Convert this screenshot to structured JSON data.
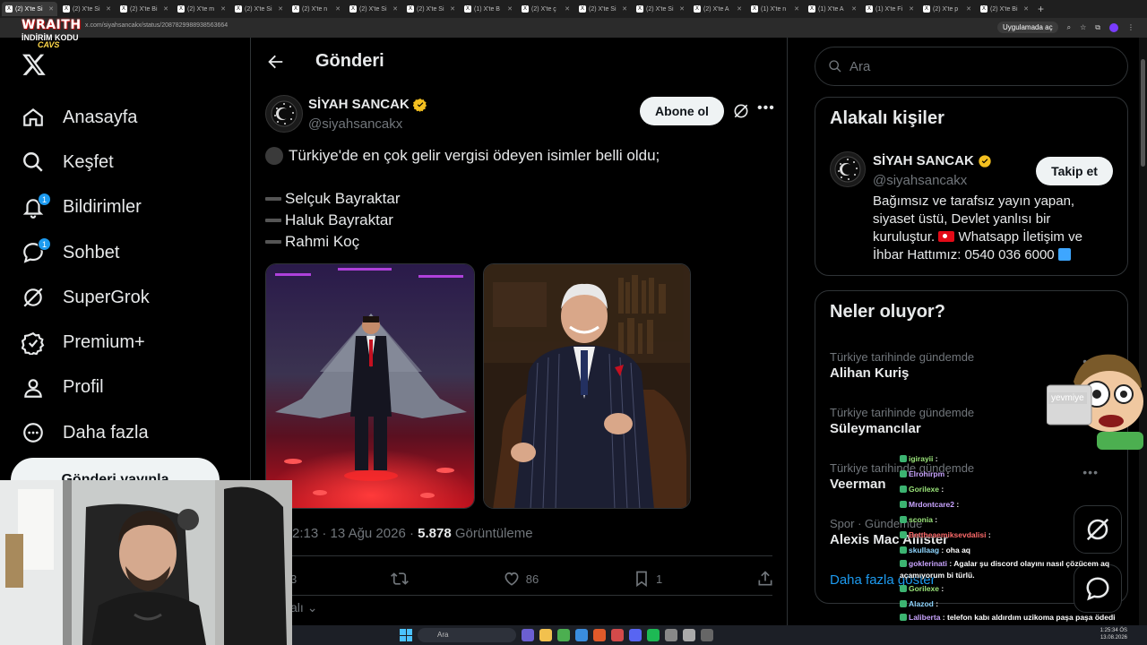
{
  "browser": {
    "tabs": [
      {
        "label": "(2) X'te Si",
        "active": true
      },
      {
        "label": "(2) X'te Si",
        "active": false
      },
      {
        "label": "(2) X'te Bi",
        "active": false
      },
      {
        "label": "(2) X'te m",
        "active": false
      },
      {
        "label": "(2) X'te Si",
        "active": false
      },
      {
        "label": "(2) X'te n",
        "active": false
      },
      {
        "label": "(2) X'te Si",
        "active": false
      },
      {
        "label": "(2) X'te Si",
        "active": false
      },
      {
        "label": "(1) X'te B",
        "active": false
      },
      {
        "label": "(2) X'te ç",
        "active": false
      },
      {
        "label": "(2) X'te Si",
        "active": false
      },
      {
        "label": "(2) X'te Si",
        "active": false
      },
      {
        "label": "(2) X'te A",
        "active": false
      },
      {
        "label": "(1) X'te n",
        "active": false
      },
      {
        "label": "(1) X'te A",
        "active": false
      },
      {
        "label": "(1) X'te Fi",
        "active": false
      },
      {
        "label": "(2) X'te p",
        "active": false
      },
      {
        "label": "(2) X'te Bi",
        "active": false
      }
    ],
    "new_tab": "+",
    "url": "x.com/siyahsancakx/status/2087829988938563664",
    "apps_label": "Uygulamada aç"
  },
  "overlay_logo": {
    "brand": "WRAITH",
    "line": "İNDİRİM KODU",
    "code": "CAVS"
  },
  "nav": {
    "items": [
      {
        "label": "Anasayfa",
        "icon": "home-icon",
        "badge": ""
      },
      {
        "label": "Keşfet",
        "icon": "search-icon",
        "badge": ""
      },
      {
        "label": "Bildirimler",
        "icon": "bell-icon",
        "badge": "1"
      },
      {
        "label": "Sohbet",
        "icon": "chat-icon",
        "badge": "1"
      },
      {
        "label": "SuperGrok",
        "icon": "grok-icon",
        "badge": ""
      },
      {
        "label": "Premium+",
        "icon": "verified-icon",
        "badge": ""
      },
      {
        "label": "Profil",
        "icon": "person-icon",
        "badge": ""
      },
      {
        "label": "Daha fazla",
        "icon": "more-circle-icon",
        "badge": ""
      }
    ],
    "post_button": "Gönderi yayınla"
  },
  "main": {
    "title": "Gönderi",
    "author_name": "SİYAH SANCAK",
    "author_handle": "@siyahsancakx",
    "subscribe_label": "Abone ol",
    "text_intro": "Türkiye'de en çok gelir vergisi ödeyen isimler belli oldu;",
    "names": [
      "Selçuk Bayraktar",
      "Haluk Bayraktar",
      "Rahmi Koç"
    ],
    "time": "2:13",
    "date": "13 Ağu 2026",
    "views": "5.878",
    "views_label": "Görüntüleme",
    "stats": {
      "replies": "3",
      "likes": "86",
      "bookmarks": "1"
    },
    "sort_label": "alı"
  },
  "right": {
    "search_placeholder": "Ara",
    "related_title": "Alakalı kişiler",
    "related_name": "SİYAH SANCAK",
    "related_handle": "@siyahsancakx",
    "follow_label": "Takip et",
    "bio_1": "Bağımsız ve tarafsız yayın yapan, siyaset üstü, Devlet yanlısı bir kuruluştur.",
    "bio_2": "Whatsapp İletişim ve İhbar Hattımız: 0540 036 6000",
    "whats_title": "Neler oluyor?",
    "trends": [
      {
        "category": "Türkiye tarihinde gündemde",
        "name": "Alihan Kuriş"
      },
      {
        "category": "Türkiye tarihinde gündemde",
        "name": "Süleymancılar"
      },
      {
        "category": "Türkiye tarihinde gündemde",
        "name": "Veerman"
      },
      {
        "category": "Spor · Gündemde",
        "name": "Alexis Mac Allister"
      }
    ],
    "show_more": "Daha fazla göster"
  },
  "mascot": {
    "label": "yevmiye"
  },
  "chat": [
    {
      "user": "igirayii",
      "text": "",
      "color": "green"
    },
    {
      "user": "Elrohirpm",
      "text": "",
      "color": "violet"
    },
    {
      "user": "Gorilexe",
      "text": "",
      "color": "green"
    },
    {
      "user": "Mrdontcare2",
      "text": "",
      "color": "violet"
    },
    {
      "user": "sconia",
      "text": "",
      "color": "green"
    },
    {
      "user": "Bettheaemiksevdalisi",
      "text": "",
      "color": "red"
    },
    {
      "user": "skullaag",
      "text": "oha aq",
      "color": "blue"
    },
    {
      "user": "goklerinati",
      "text": "Agalar şu discord olayını nasıl çözücem aq açamıyorum bi türlü.",
      "color": "violet"
    },
    {
      "user": "Gorilexe",
      "text": "",
      "color": "green"
    },
    {
      "user": "Alazod",
      "text": "",
      "color": "blue"
    },
    {
      "user": "Laliberta",
      "text": "telefon kabı aldırdım uzikoma paşa paşa ödedi",
      "color": "violet"
    }
  ],
  "taskbar": {
    "search_label": "Ara",
    "time": "1:25:34 ÖS",
    "date": "13.08.2026"
  },
  "colors": {
    "accent": "#1d9bf0",
    "verified": "#f4c020",
    "background": "#000000"
  }
}
